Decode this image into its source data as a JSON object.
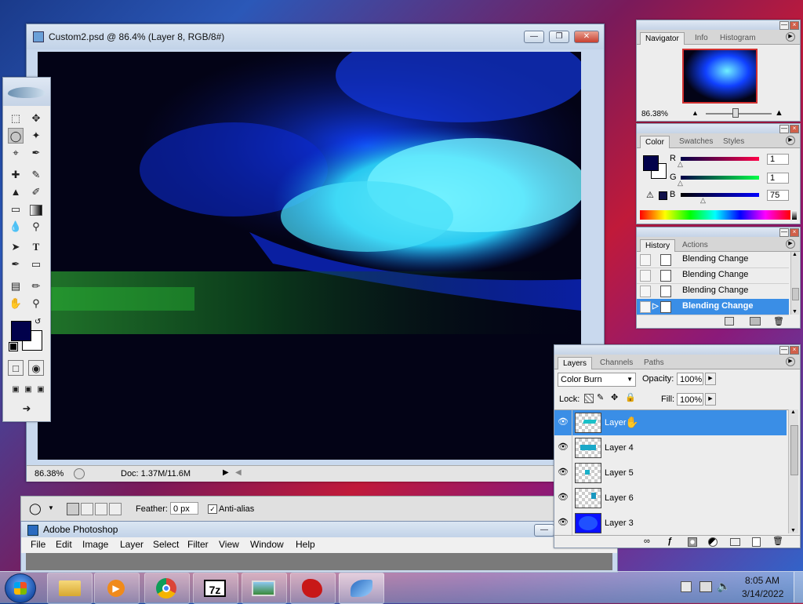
{
  "document_window": {
    "title": "Custom2.psd @ 86.4% (Layer 8, RGB/8#)",
    "zoom": "86.38%",
    "doc_info": "Doc: 1.37M/11.6M"
  },
  "navigator": {
    "tabs": [
      "Navigator",
      "Info",
      "Histogram"
    ],
    "zoom": "86.38%"
  },
  "color_panel": {
    "tabs": [
      "Color",
      "Swatches",
      "Styles"
    ],
    "channels": [
      {
        "label": "R",
        "value": "1"
      },
      {
        "label": "G",
        "value": "1"
      },
      {
        "label": "B",
        "value": "75"
      }
    ],
    "foreground": "#01014b"
  },
  "history": {
    "tabs": [
      "History",
      "Actions"
    ],
    "items": [
      "Blending Change",
      "Blending Change",
      "Blending Change",
      "Blending Change"
    ]
  },
  "layers": {
    "tabs": [
      "Layers",
      "Channels",
      "Paths"
    ],
    "blend_mode": "Color Burn",
    "opacity_label": "Opacity:",
    "opacity": "100%",
    "lock_label": "Lock:",
    "fill_label": "Fill:",
    "fill": "100%",
    "items": [
      "Layer 8",
      "Layer 4",
      "Layer 5",
      "Layer 6",
      "Layer 3"
    ]
  },
  "options_bar": {
    "feather_label": "Feather:",
    "feather_value": "0 px",
    "antialias_label": "Anti-alias"
  },
  "app_window": {
    "title": "Adobe Photoshop",
    "menu": [
      "File",
      "Edit",
      "Image",
      "Layer",
      "Select",
      "Filter",
      "View",
      "Window",
      "Help"
    ]
  },
  "taskbar": {
    "apps": [
      "file-explorer",
      "media-player",
      "chrome",
      "7zip",
      "photo-viewer",
      "game",
      "photoshop"
    ],
    "app_label_7z": "7z",
    "time": "8:05 AM",
    "date": "3/14/2022"
  }
}
